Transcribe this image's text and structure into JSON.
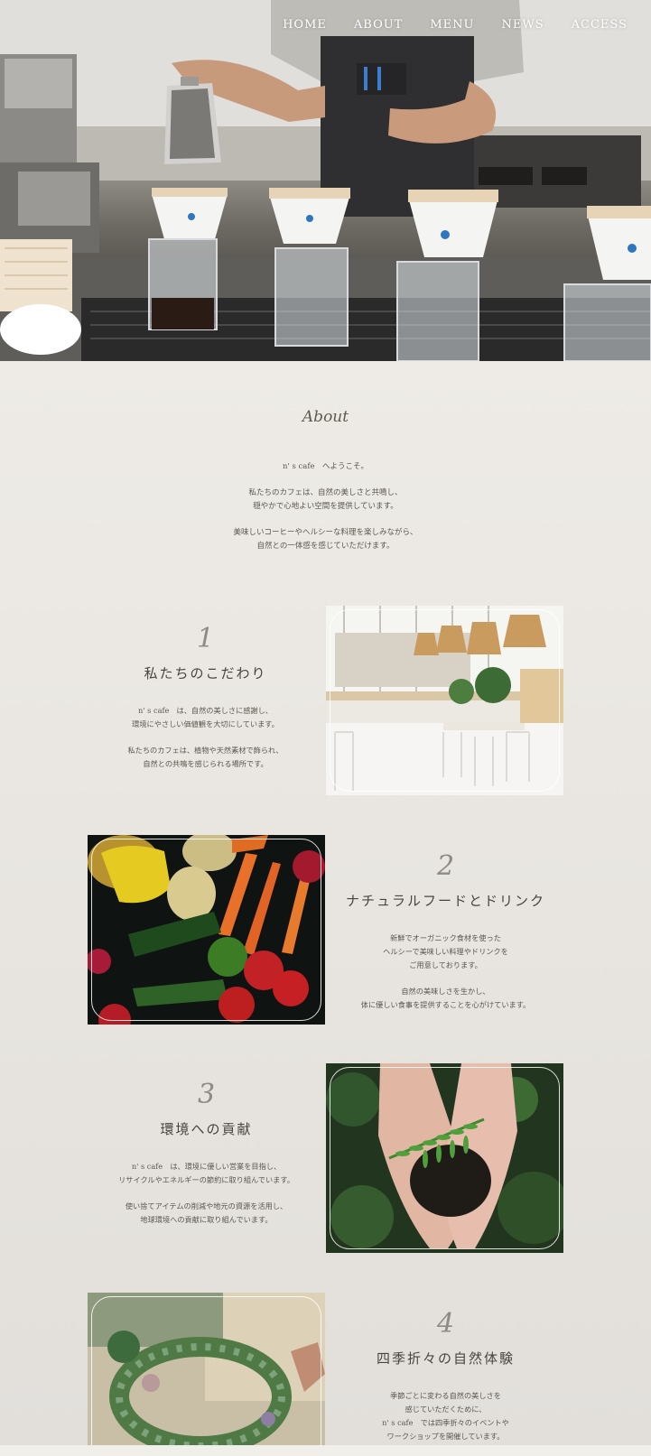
{
  "nav": [
    "HOME",
    "ABOUT",
    "MENU",
    "NEWS",
    "ACCESS"
  ],
  "about": {
    "title": "About",
    "paragraphs": [
      [
        "n' s cafe　へようこそ。"
      ],
      [
        "私たちのカフェは、自然の美しさと共鳴し、",
        "穏やかで心地よい空間を提供しています。"
      ],
      [
        "美味しいコーヒーやヘルシーな料理を楽しみながら、",
        "自然との一体感を感じていただけます。"
      ]
    ]
  },
  "features": [
    {
      "number": "1",
      "heading": "私たちのこだわり",
      "lines": [
        "n' s cafe　は、自然の美しさに感謝し、",
        "環境にやさしい価値観を大切にしています。",
        "",
        "私たちのカフェは、植物や天然素材で飾られ、",
        "自然との共鳴を感じられる場所です。"
      ],
      "image": "cafe-interior"
    },
    {
      "number": "2",
      "heading": "ナチュラルフードとドリンク",
      "lines": [
        "新鮮でオーガニック食材を使った",
        "ヘルシーで美味しい料理やドリンクを",
        "ご用意しております。",
        "",
        "自然の美味しさを生かし、",
        "体に優しい食事を提供することを心がけています。"
      ],
      "image": "vegetables"
    },
    {
      "number": "3",
      "heading": "環境への貢献",
      "lines": [
        "n' s cafe　は、環境に優しい営業を目指し、",
        "リサイクルやエネルギーの節約に取り組んでいます。",
        "",
        "使い捨てアイテムの削減や地元の資源を活用し、",
        "地球環境への貢献に取り組んでいます。"
      ],
      "image": "hands-soil-plant"
    },
    {
      "number": "4",
      "heading": "四季折々の自然体験",
      "lines": [
        "季節ごとに変わる自然の美しさを",
        "感じていただくために、",
        "n' s cafe　では四季折々のイベントや",
        "ワークショップを開催しています。"
      ],
      "image": "wreath-making"
    }
  ]
}
